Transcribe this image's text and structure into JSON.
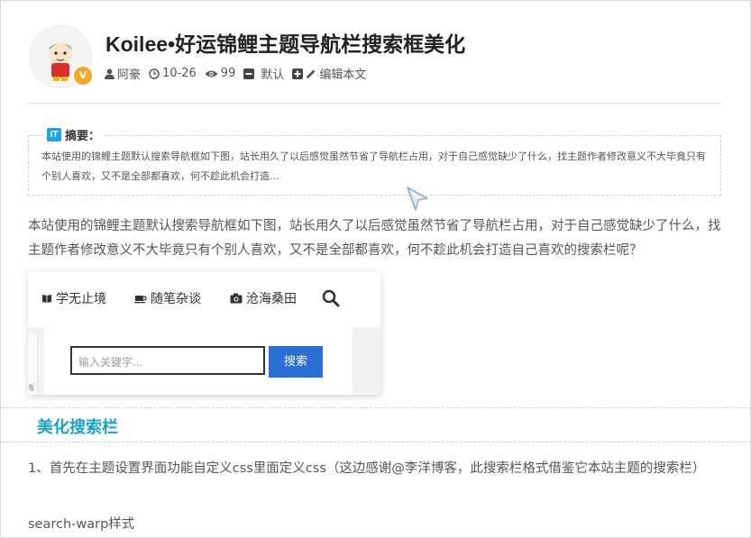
{
  "header": {
    "title": "Koilee•好运锦鲤主题导航栏搜索框美化",
    "badge": "V",
    "meta": {
      "author": "阿豪",
      "date": "10-26",
      "views": "99",
      "category_prefix": "默认",
      "edit": "编辑本文"
    }
  },
  "summary": {
    "badge": "IT",
    "heading": "摘要：",
    "text": "本站使用的锦鲤主题默认搜索导航框如下图，站长用久了以后感觉虽然节省了导航栏占用，对于自己感觉缺少了什么，找主题作者修改意义不大毕竟只有个别人喜欢，又不是全部都喜欢，何不趁此机会打造..."
  },
  "body": {
    "para1": "本站使用的锦鲤主题默认搜索导航框如下图，站长用久了以后感觉虽然节省了导航栏占用，对于自己感觉缺少了什么，找主题作者修改意义不大毕竟只有个别人喜欢，又不是全部都喜欢，何不趁此机会打造自己喜欢的搜索栏呢？",
    "screenshot": {
      "nav": [
        "学无止境",
        "随笔杂谈",
        "沧海桑田"
      ],
      "input_placeholder": "输入关键字...",
      "search_button": "搜索",
      "tiny": "ɮ"
    },
    "section_heading": "美化搜索栏",
    "para2": "1、首先在主题设置界面功能自定义css里面定义css（这边感谢@李洋博客，此搜索栏格式借鉴它本站主题的搜索栏）",
    "para3": "search-warp样式"
  },
  "colors": {
    "accent": "#1aa3c8",
    "button": "#2a6fd8",
    "badge": "#f5a623"
  }
}
